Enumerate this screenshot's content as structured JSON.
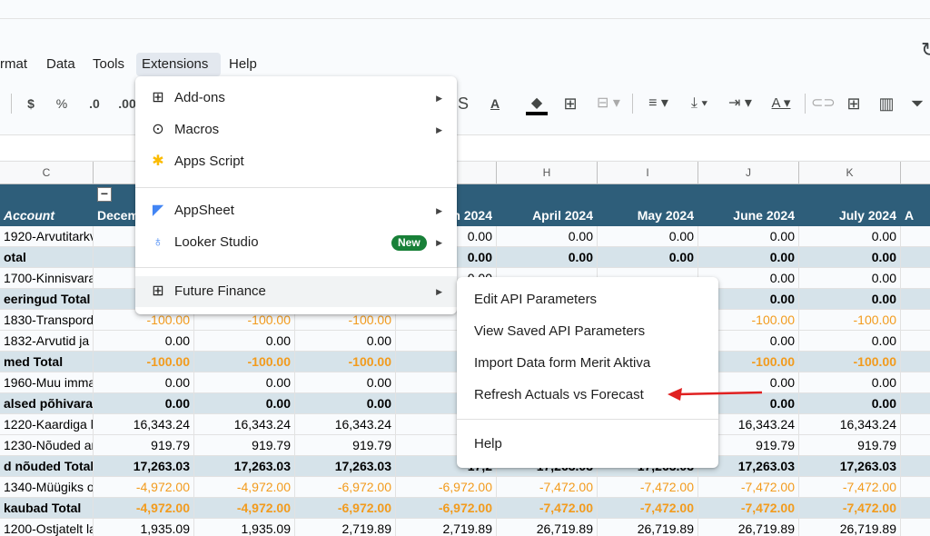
{
  "header": {
    "history_icon": "history-icon"
  },
  "menubar": {
    "items": [
      "rmat",
      "Data",
      "Tools",
      "Extensions",
      "Help"
    ],
    "active": "Extensions"
  },
  "toolbar": {
    "currency": "$",
    "percent": "%",
    "dec_decrease": ".0",
    "dec_increase": ".00",
    "text_color_letter": "A",
    "text_color_letter2": "A"
  },
  "columns": [
    "C",
    "",
    "",
    "",
    "H",
    "I",
    "J",
    "K",
    ""
  ],
  "grid": {
    "header_row": [
      "Account",
      "Decem",
      "",
      "",
      "h 2024",
      "April 2024",
      "May 2024",
      "June 2024",
      "July 2024",
      "A"
    ],
    "rows": [
      {
        "type": "normal",
        "cells": [
          "1920-Arvutitarkv",
          "",
          "",
          "",
          "0.00",
          "0.00",
          "0.00",
          "0.00",
          "0.00"
        ]
      },
      {
        "type": "total",
        "cells": [
          "otal",
          "",
          "",
          "",
          "0.00",
          "0.00",
          "0.00",
          "0.00",
          "0.00"
        ]
      },
      {
        "type": "normal",
        "cells": [
          "1700-Kinnisvara",
          "",
          "",
          "",
          "0.00",
          "",
          "",
          "0.00",
          "0.00"
        ]
      },
      {
        "type": "total",
        "cells": [
          "eeringud Total",
          "",
          "",
          "",
          "",
          "",
          "",
          "0.00",
          "0.00"
        ]
      },
      {
        "type": "normal",
        "orange": true,
        "cells": [
          "1830-Transpordi",
          "-100.00",
          "-100.00",
          "-100.00",
          "",
          "",
          "",
          "-100.00",
          "-100.00"
        ]
      },
      {
        "type": "normal",
        "cells": [
          "1832-Arvutid ja a",
          "0.00",
          "0.00",
          "0.00",
          "",
          "",
          "",
          "0.00",
          "0.00"
        ]
      },
      {
        "type": "total",
        "orange": true,
        "cells": [
          "med Total",
          "-100.00",
          "-100.00",
          "-100.00",
          "-1",
          "",
          "",
          "-100.00",
          "-100.00"
        ]
      },
      {
        "type": "normal",
        "cells": [
          "1960-Muu imma",
          "0.00",
          "0.00",
          "0.00",
          "",
          "",
          "",
          "0.00",
          "0.00"
        ]
      },
      {
        "type": "total",
        "cells": [
          "alsed põhivara",
          "0.00",
          "0.00",
          "0.00",
          "",
          "",
          "",
          "0.00",
          "0.00"
        ]
      },
      {
        "type": "normal",
        "cells": [
          "1220-Kaardiga la",
          "16,343.24",
          "16,343.24",
          "16,343.24",
          "16,3",
          "",
          "",
          "16,343.24",
          "16,343.24"
        ]
      },
      {
        "type": "normal",
        "cells": [
          "1230-Nõuded ar",
          "919.79",
          "919.79",
          "919.79",
          "9",
          "",
          "",
          "919.79",
          "919.79"
        ]
      },
      {
        "type": "total",
        "cells": [
          "d nõuded Total",
          "17,263.03",
          "17,263.03",
          "17,263.03",
          "17,2",
          "17,263.03",
          "17,263.03",
          "17,263.03",
          "17,263.03"
        ]
      },
      {
        "type": "normal",
        "orange": true,
        "cells": [
          "1340-Müügiks o",
          "-4,972.00",
          "-4,972.00",
          "-6,972.00",
          "-6,972.00",
          "-7,472.00",
          "-7,472.00",
          "-7,472.00",
          "-7,472.00"
        ]
      },
      {
        "type": "total",
        "orange": true,
        "cells": [
          "kaubad Total",
          "-4,972.00",
          "-4,972.00",
          "-6,972.00",
          "-6,972.00",
          "-7,472.00",
          "-7,472.00",
          "-7,472.00",
          "-7,472.00"
        ]
      },
      {
        "type": "normal",
        "cells": [
          "1200-Ostjatelt la",
          "1,935.09",
          "1,935.09",
          "2,719.89",
          "2,719.89",
          "26,719.89",
          "26,719.89",
          "26,719.89",
          "26,719.89"
        ]
      }
    ]
  },
  "extensions_menu": {
    "items": [
      {
        "label": "Add-ons",
        "icon": "add-ons-icon",
        "submenu": true
      },
      {
        "label": "Macros",
        "icon": "macros-icon",
        "submenu": true
      },
      {
        "label": "Apps Script",
        "icon": "apps-script-icon",
        "submenu": false
      },
      {
        "label": "AppSheet",
        "icon": "appsheet-icon",
        "submenu": true
      },
      {
        "label": "Looker Studio",
        "icon": "looker-studio-icon",
        "submenu": true,
        "badge": "New"
      },
      {
        "label": "Future Finance",
        "icon": "future-finance-icon",
        "submenu": true
      }
    ]
  },
  "future_finance_menu": {
    "items": [
      "Edit API Parameters",
      "View Saved API Parameters",
      "Import Data form Merit Aktiva",
      "Refresh Actuals vs Forecast",
      "Help"
    ]
  },
  "colors": {
    "header_blue": "#2e5e7a",
    "total_bg": "#d6e3ea",
    "negative_orange": "#f29b1d",
    "badge_green": "#188038",
    "annotation_red": "#e02020"
  }
}
